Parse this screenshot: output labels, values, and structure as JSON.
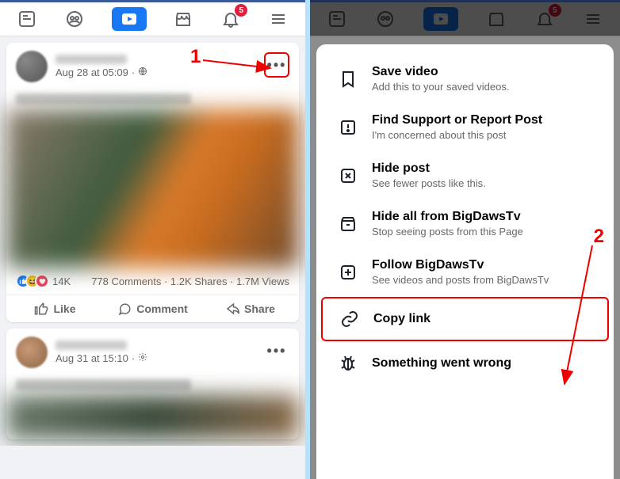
{
  "nav": {
    "badge_count": "5"
  },
  "post1": {
    "date": "Aug 28 at 05:09",
    "sep": "·",
    "react_count": "14K",
    "comments": "778 Comments",
    "shares": "1.2K Shares",
    "views": "1.7M Views",
    "like": "Like",
    "comment": "Comment",
    "share": "Share"
  },
  "post2": {
    "date": "Aug 31 at 15:10",
    "sep": "·"
  },
  "sheet": {
    "save": {
      "title": "Save video",
      "sub": "Add this to your saved videos."
    },
    "report": {
      "title": "Find Support or Report Post",
      "sub": "I'm concerned about this post"
    },
    "hide": {
      "title": "Hide post",
      "sub": "See fewer posts like this."
    },
    "hideall": {
      "title": "Hide all from BigDawsTv",
      "sub": "Stop seeing posts from this Page"
    },
    "follow": {
      "title": "Follow BigDawsTv",
      "sub": "See videos and posts from BigDawsTv"
    },
    "copylink": {
      "title": "Copy link"
    },
    "wrong": {
      "title": "Something went wrong"
    }
  },
  "annotations": {
    "one": "1",
    "two": "2"
  }
}
